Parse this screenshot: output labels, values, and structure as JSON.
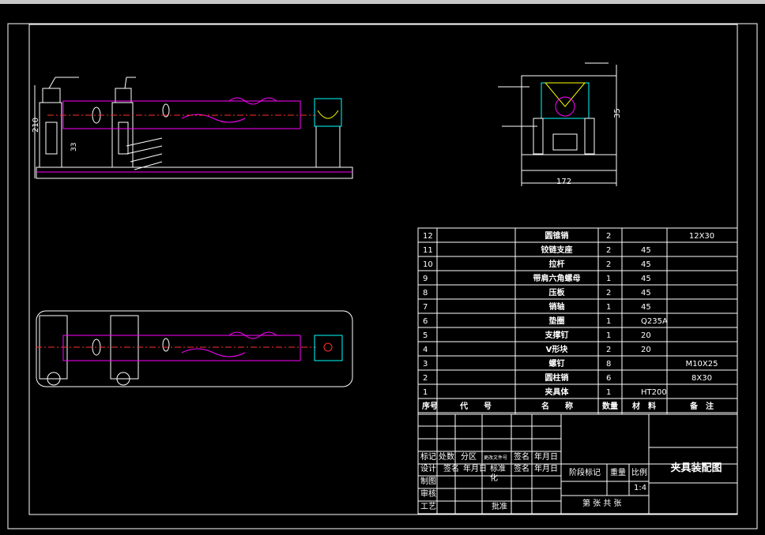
{
  "drawing": {
    "title": "夹具装配图",
    "scale": "1:4",
    "sheet_info": "第 张   共 张",
    "dims": {
      "height_210": "210",
      "dim_33": "33",
      "dim_172": "172",
      "dim_35": "35"
    },
    "colors": {
      "outline": "#ffffff",
      "hidden": "#ff00ff",
      "section": "#00ffff",
      "highlight": "#ffff00",
      "red": "#ff3030"
    }
  },
  "bom": {
    "headers": {
      "no": "序号",
      "code": "代　　号",
      "name": "名　　称",
      "qty": "数量",
      "material": "材　料",
      "remark": "备　注"
    },
    "rows": [
      {
        "no": "12",
        "name": "圆锥销",
        "qty": "2",
        "material": "",
        "remark": "12X30"
      },
      {
        "no": "11",
        "name": "铰链支座",
        "qty": "2",
        "material": "45",
        "remark": ""
      },
      {
        "no": "10",
        "name": "拉杆",
        "qty": "2",
        "material": "45",
        "remark": ""
      },
      {
        "no": "9",
        "name": "带肩六角螺母",
        "qty": "1",
        "material": "45",
        "remark": ""
      },
      {
        "no": "8",
        "name": "压板",
        "qty": "2",
        "material": "45",
        "remark": ""
      },
      {
        "no": "7",
        "name": "销轴",
        "qty": "1",
        "material": "45",
        "remark": ""
      },
      {
        "no": "6",
        "name": "垫圈",
        "qty": "1",
        "material": "Q235A",
        "remark": ""
      },
      {
        "no": "5",
        "name": "支撑钉",
        "qty": "1",
        "material": "20",
        "remark": ""
      },
      {
        "no": "4",
        "name": "V形块",
        "qty": "2",
        "material": "20",
        "remark": ""
      },
      {
        "no": "3",
        "name": "螺钉",
        "qty": "8",
        "material": "",
        "remark": "M10X25"
      },
      {
        "no": "2",
        "name": "圆柱销",
        "qty": "6",
        "material": "",
        "remark": "8X30"
      },
      {
        "no": "1",
        "name": "夹具体",
        "qty": "1",
        "material": "HT200",
        "remark": ""
      }
    ]
  },
  "title_block": {
    "mark": "标记",
    "count": "处数",
    "zone": "分区",
    "change_doc": "更改文件号",
    "sign": "签名",
    "date": "年月日",
    "design": "设计",
    "sign2": "签名",
    "date2": "年月日",
    "standard": "标准化",
    "sign3": "签名",
    "date3": "年月日",
    "stage_mark": "阶段标记",
    "weight": "重量",
    "ratio": "比例",
    "drawn": "制图",
    "review": "审核",
    "process": "工艺",
    "approve": "批准"
  }
}
